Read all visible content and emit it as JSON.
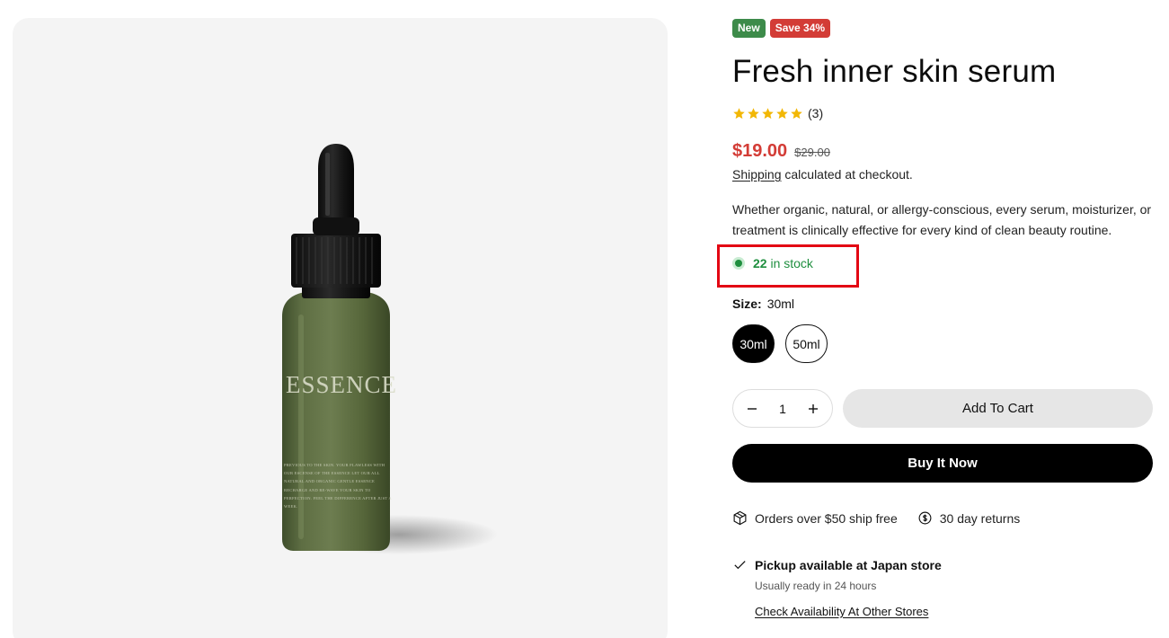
{
  "product": {
    "badges": {
      "new": "New",
      "sale": "Save 34%"
    },
    "title": "Fresh inner skin serum",
    "rating": {
      "stars": 5,
      "review_count": "(3)"
    },
    "price": {
      "sale": "$19.00",
      "compare_at": "$29.00",
      "sale_color": "#d33c36"
    },
    "shipping": {
      "link_text": "Shipping",
      "rest_text": " calculated at checkout."
    },
    "description": "Whether organic, natural, or allergy-conscious, every serum, moisturizer, or treatment is clinically effective for every kind of clean beauty routine.",
    "stock": {
      "count": "22",
      "text": " in stock",
      "color": "#1f8f3f"
    },
    "size": {
      "label": "Size:",
      "selected": "30ml",
      "options": [
        "30ml",
        "50ml"
      ]
    },
    "quantity": {
      "value": "1"
    },
    "buttons": {
      "add_to_cart": "Add To Cart",
      "buy_now": "Buy It Now"
    },
    "perks": {
      "shipping": "Orders over $50 ship free",
      "returns": "30 day returns"
    },
    "pickup": {
      "title": "Pickup available at Japan store",
      "subtitle": "Usually ready in 24 hours",
      "link": "Check Availability At Other Stores"
    }
  },
  "media": {
    "bottle_label": "ESSENCE",
    "bottle_fine_print": "PREVIOUS TO THE SKIN. YOUR FLAWLESS WITH OUR ESCENSE OF THE ESSENCE LET OUR ALL NATURAL AND ORGANIC GENTLE ESSENCE RECHARGE AND RE-WAVE YOUR SKIN TO PERFECTION. FEEL THE DIFFERENCE AFTER JUST A WEEK."
  },
  "colors": {
    "accent_badge_new": "#3d8b4a",
    "highlight_box": "#e30613",
    "star": "#f2b705"
  }
}
